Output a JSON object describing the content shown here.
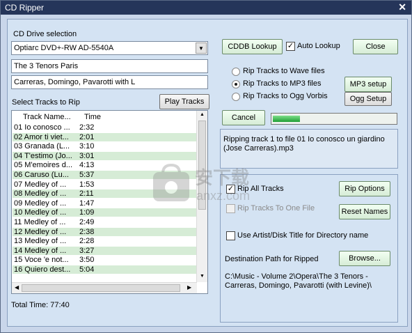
{
  "window": {
    "title": "CD Ripper",
    "close_glyph": "✕"
  },
  "drive": {
    "label": "CD Drive selection",
    "selected": "Optiarc  DVD+-RW AD-5540A"
  },
  "album_title": "The 3 Tenors Paris",
  "artist": "Carreras, Domingo, Pavarotti with L",
  "tracks": {
    "label": "Select Tracks to Rip",
    "play_button": "Play Tracks",
    "col_name": "Track Name...",
    "col_time": "Time",
    "rows": [
      {
        "name": "01 Io conosco ...",
        "time": "2:32"
      },
      {
        "name": "02 Amor ti viet...",
        "time": "2:01"
      },
      {
        "name": "03 Granada (L...",
        "time": "3:10"
      },
      {
        "name": "04 T'estimo (Jo...",
        "time": "3:01"
      },
      {
        "name": "05 M'emoires d...",
        "time": "4:13"
      },
      {
        "name": "06 Caruso (Lu...",
        "time": "5:37"
      },
      {
        "name": "07 Medley of ...",
        "time": "1:53"
      },
      {
        "name": "08 Medley of ...",
        "time": "2:11"
      },
      {
        "name": "09 Medley of ...",
        "time": "1:47"
      },
      {
        "name": "10 Medley of ...",
        "time": "1:09"
      },
      {
        "name": "11 Medley of ...",
        "time": "2:49"
      },
      {
        "name": "12 Medley of ...",
        "time": "2:38"
      },
      {
        "name": "13 Medley of ...",
        "time": "2:28"
      },
      {
        "name": "14 Medley of ...",
        "time": "3:27"
      },
      {
        "name": "15 Voce 'e not...",
        "time": "3:50"
      },
      {
        "name": "16 Quiero dest...",
        "time": "5:04"
      }
    ],
    "total_time": "Total Time: 77:40"
  },
  "cddb": {
    "lookup_button": "CDDB Lookup",
    "auto_lookup": "Auto Lookup",
    "close_button": "Close"
  },
  "formats": {
    "wave": "Rip Tracks to Wave files",
    "mp3": "Rip Tracks to MP3 files",
    "ogg": "Rip Tracks to Ogg Vorbis",
    "mp3_setup": "MP3 setup",
    "ogg_setup": "Ogg Setup",
    "selected": "mp3"
  },
  "rip": {
    "cancel_button": "Cancel",
    "progress": 0.22,
    "status": "Ripping track 1 to file 01 Io conosco un giardino (Jose Carreras).mp3"
  },
  "options": {
    "rip_all": "Rip All Tracks",
    "rip_options_button": "Rip Options",
    "rip_one_file": "Rip Tracks To One File",
    "reset_names_button": "Reset Names",
    "use_artist_dir": "Use Artist/Disk Title for Directory name",
    "dest_label": "Destination Path for Ripped",
    "browse_button": "Browse...",
    "dest_path": "C:\\Music - Volume 2\\Opera\\The 3 Tenors - Carreras, Domingo, Pavarotti (with Levine)\\"
  },
  "colors": {
    "title_bar": "#25355a",
    "pane": "#d4e3f3",
    "row_alt": "#d6ecd6",
    "progress": "#1f9e35"
  },
  "watermark": {
    "text": "安下载",
    "sub": "anxz.com"
  }
}
